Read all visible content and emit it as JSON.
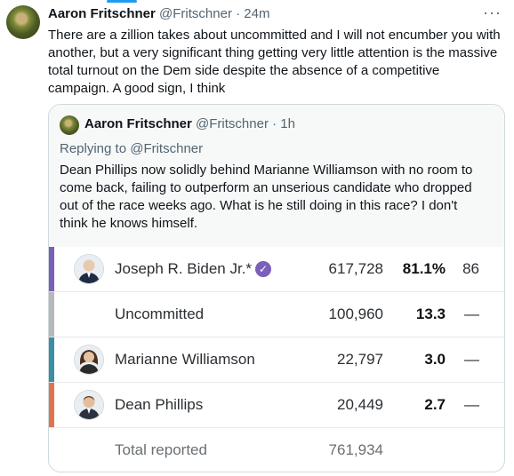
{
  "tweet": {
    "author_name": "Aaron Fritschner",
    "handle_time": "@Fritschner · 24m",
    "more_label": "···",
    "text": "There are a zillion takes about uncommitted and I will not encumber you with another, but a very significant thing getting very little attention is the massive total turnout on the Dem side despite the absence of a competitive campaign. A good sign, I think"
  },
  "quote": {
    "author_name": "Aaron Fritschner",
    "handle_time": "@Fritschner · 1h",
    "replying_prefix": "Replying to ",
    "replying_handle": "@Fritschner",
    "text": "Dean Phillips now solidly behind Marianne Williamson with no room to come back, failing to outperform an unserious candidate who dropped out of the race weeks ago. What is he still doing in this race? I don't think he knows himself."
  },
  "results": {
    "rows": [
      {
        "name": "Joseph R. Biden Jr.*",
        "votes": "617,728",
        "pct": "81.1%",
        "delegates": "86",
        "color": "#7b5fb8",
        "verified_icon": "check-icon"
      },
      {
        "name": "Uncommitted",
        "votes": "100,960",
        "pct": "13.3",
        "delegates": "—",
        "color": "#b8b8b8"
      },
      {
        "name": "Marianne Williamson",
        "votes": "22,797",
        "pct": "3.0",
        "delegates": "—",
        "color": "#3b8fa3"
      },
      {
        "name": "Dean Phillips",
        "votes": "20,449",
        "pct": "2.7",
        "delegates": "—",
        "color": "#e0734a"
      }
    ],
    "total_label": "Total reported",
    "total_votes": "761,934",
    "check_glyph": "✓"
  }
}
